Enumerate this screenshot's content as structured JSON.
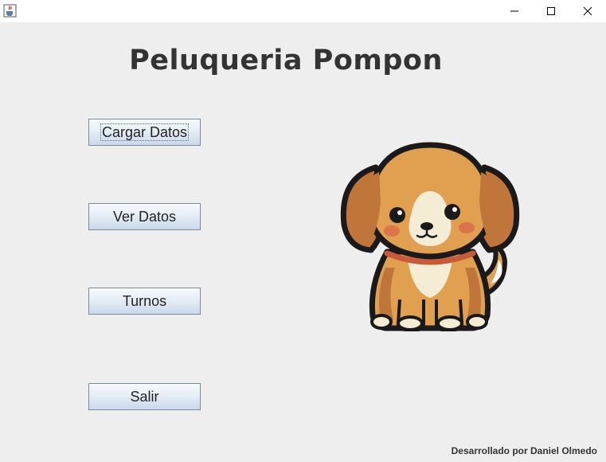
{
  "window": {
    "app_icon": "java-cup-icon",
    "controls": [
      "minimize-icon",
      "maximize-icon",
      "close-icon"
    ]
  },
  "title": "Peluqueria Pompon",
  "buttons": {
    "cargar": "Cargar Datos",
    "ver": "Ver Datos",
    "turnos": "Turnos",
    "salir": "Salir"
  },
  "image": "puppy-illustration",
  "footer": "Desarrollado por Daniel Olmedo",
  "colors": {
    "background": "#eeeeee",
    "dog_fur": "#e0a050",
    "dog_ears": "#c0763a",
    "dog_outline": "#1a1a1a"
  }
}
